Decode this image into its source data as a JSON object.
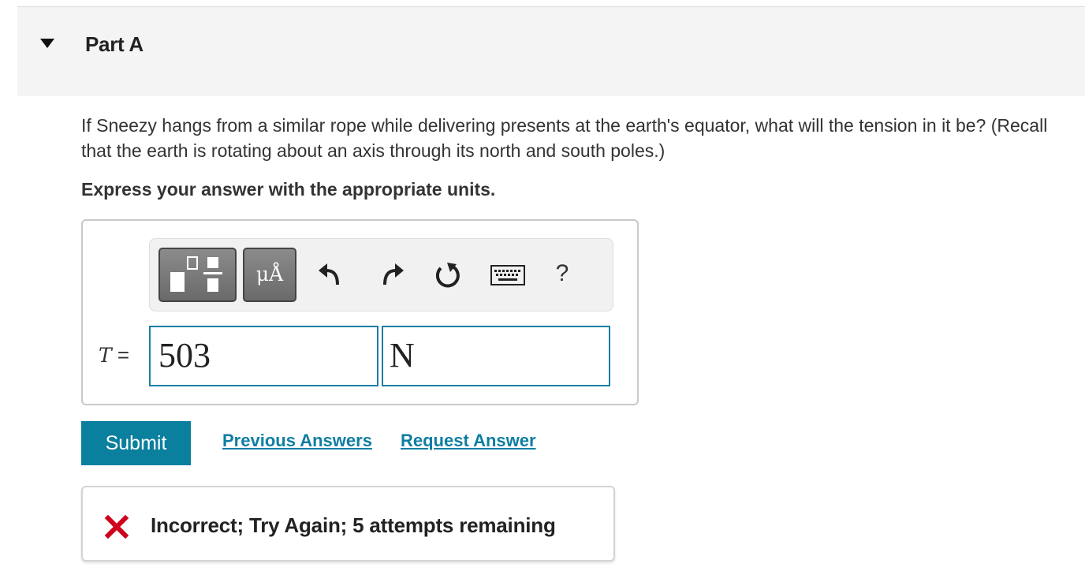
{
  "part": {
    "title": "Part A"
  },
  "question": {
    "text": "If Sneezy hangs from a similar rope while delivering presents at the earth's equator, what will the tension in it be? (Recall that the earth is rotating about an axis through its north and south poles.)",
    "instruction": "Express your answer with the appropriate units."
  },
  "toolbar": {
    "units_label": "μÅ",
    "help_label": "?",
    "icons": [
      "templates-icon",
      "units-icon",
      "undo-icon",
      "redo-icon",
      "reset-icon",
      "keyboard-icon",
      "help-icon"
    ]
  },
  "answer": {
    "variable": "T",
    "equals": "=",
    "value": "503",
    "units": "N"
  },
  "actions": {
    "submit_label": "Submit",
    "previous_answers_label": "Previous Answers",
    "request_answer_label": "Request Answer"
  },
  "feedback": {
    "text": "Incorrect; Try Again; 5 attempts remaining"
  },
  "colors": {
    "accent": "#0a7f9e",
    "link": "#0e7ea3",
    "input_border": "#1a7fa3",
    "error": "#d0021b"
  }
}
